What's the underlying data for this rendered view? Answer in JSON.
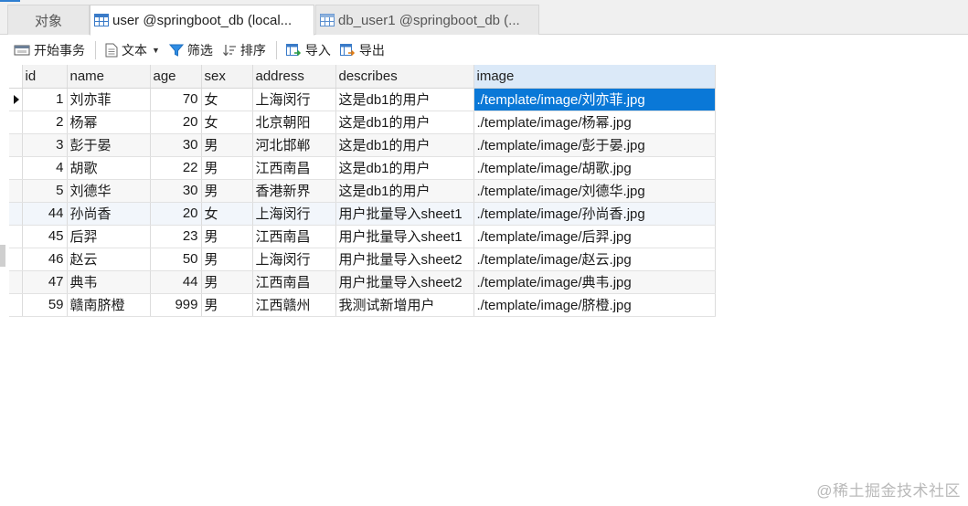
{
  "tabs": [
    {
      "label": "对象",
      "icon": "none"
    },
    {
      "label": "user @springboot_db (local...",
      "icon": "table-icon",
      "active": true
    },
    {
      "label": "db_user1 @springboot_db (...",
      "icon": "table-icon"
    }
  ],
  "toolbar": {
    "begin_transaction": "开始事务",
    "text": "文本",
    "filter": "筛选",
    "sort": "排序",
    "import": "导入",
    "export": "导出"
  },
  "grid": {
    "columns": [
      "id",
      "name",
      "age",
      "sex",
      "address",
      "describes",
      "image"
    ],
    "rows": [
      {
        "id": "1",
        "name": "刘亦菲",
        "age": "70",
        "sex": "女",
        "address": "上海闵行",
        "describes": "这是db1的用户",
        "image": "./template/image/刘亦菲.jpg"
      },
      {
        "id": "2",
        "name": "杨幂",
        "age": "20",
        "sex": "女",
        "address": "北京朝阳",
        "describes": "这是db1的用户",
        "image": "./template/image/杨幂.jpg"
      },
      {
        "id": "3",
        "name": "彭于晏",
        "age": "30",
        "sex": "男",
        "address": "河北邯郸",
        "describes": "这是db1的用户",
        "image": "./template/image/彭于晏.jpg"
      },
      {
        "id": "4",
        "name": "胡歌",
        "age": "22",
        "sex": "男",
        "address": "江西南昌",
        "describes": "这是db1的用户",
        "image": "./template/image/胡歌.jpg"
      },
      {
        "id": "5",
        "name": "刘德华",
        "age": "30",
        "sex": "男",
        "address": "香港新界",
        "describes": "这是db1的用户",
        "image": "./template/image/刘德华.jpg"
      },
      {
        "id": "44",
        "name": "孙尚香",
        "age": "20",
        "sex": "女",
        "address": "上海闵行",
        "describes": "用户批量导入sheet1",
        "image": "./template/image/孙尚香.jpg"
      },
      {
        "id": "45",
        "name": "后羿",
        "age": "23",
        "sex": "男",
        "address": "江西南昌",
        "describes": "用户批量导入sheet1",
        "image": "./template/image/后羿.jpg"
      },
      {
        "id": "46",
        "name": "赵云",
        "age": "50",
        "sex": "男",
        "address": "上海闵行",
        "describes": "用户批量导入sheet2",
        "image": "./template/image/赵云.jpg"
      },
      {
        "id": "47",
        "name": "典韦",
        "age": "44",
        "sex": "男",
        "address": "江西南昌",
        "describes": "用户批量导入sheet2",
        "image": "./template/image/典韦.jpg"
      },
      {
        "id": "59",
        "name": "赣南脐橙",
        "age": "999",
        "sex": "男",
        "address": "江西赣州",
        "describes": "我测试新增用户",
        "image": "./template/image/脐橙.jpg"
      }
    ]
  },
  "watermark": "@稀土掘金技术社区",
  "colors": {
    "selection": "#0a78d7",
    "accent": "#2f7fd1"
  }
}
